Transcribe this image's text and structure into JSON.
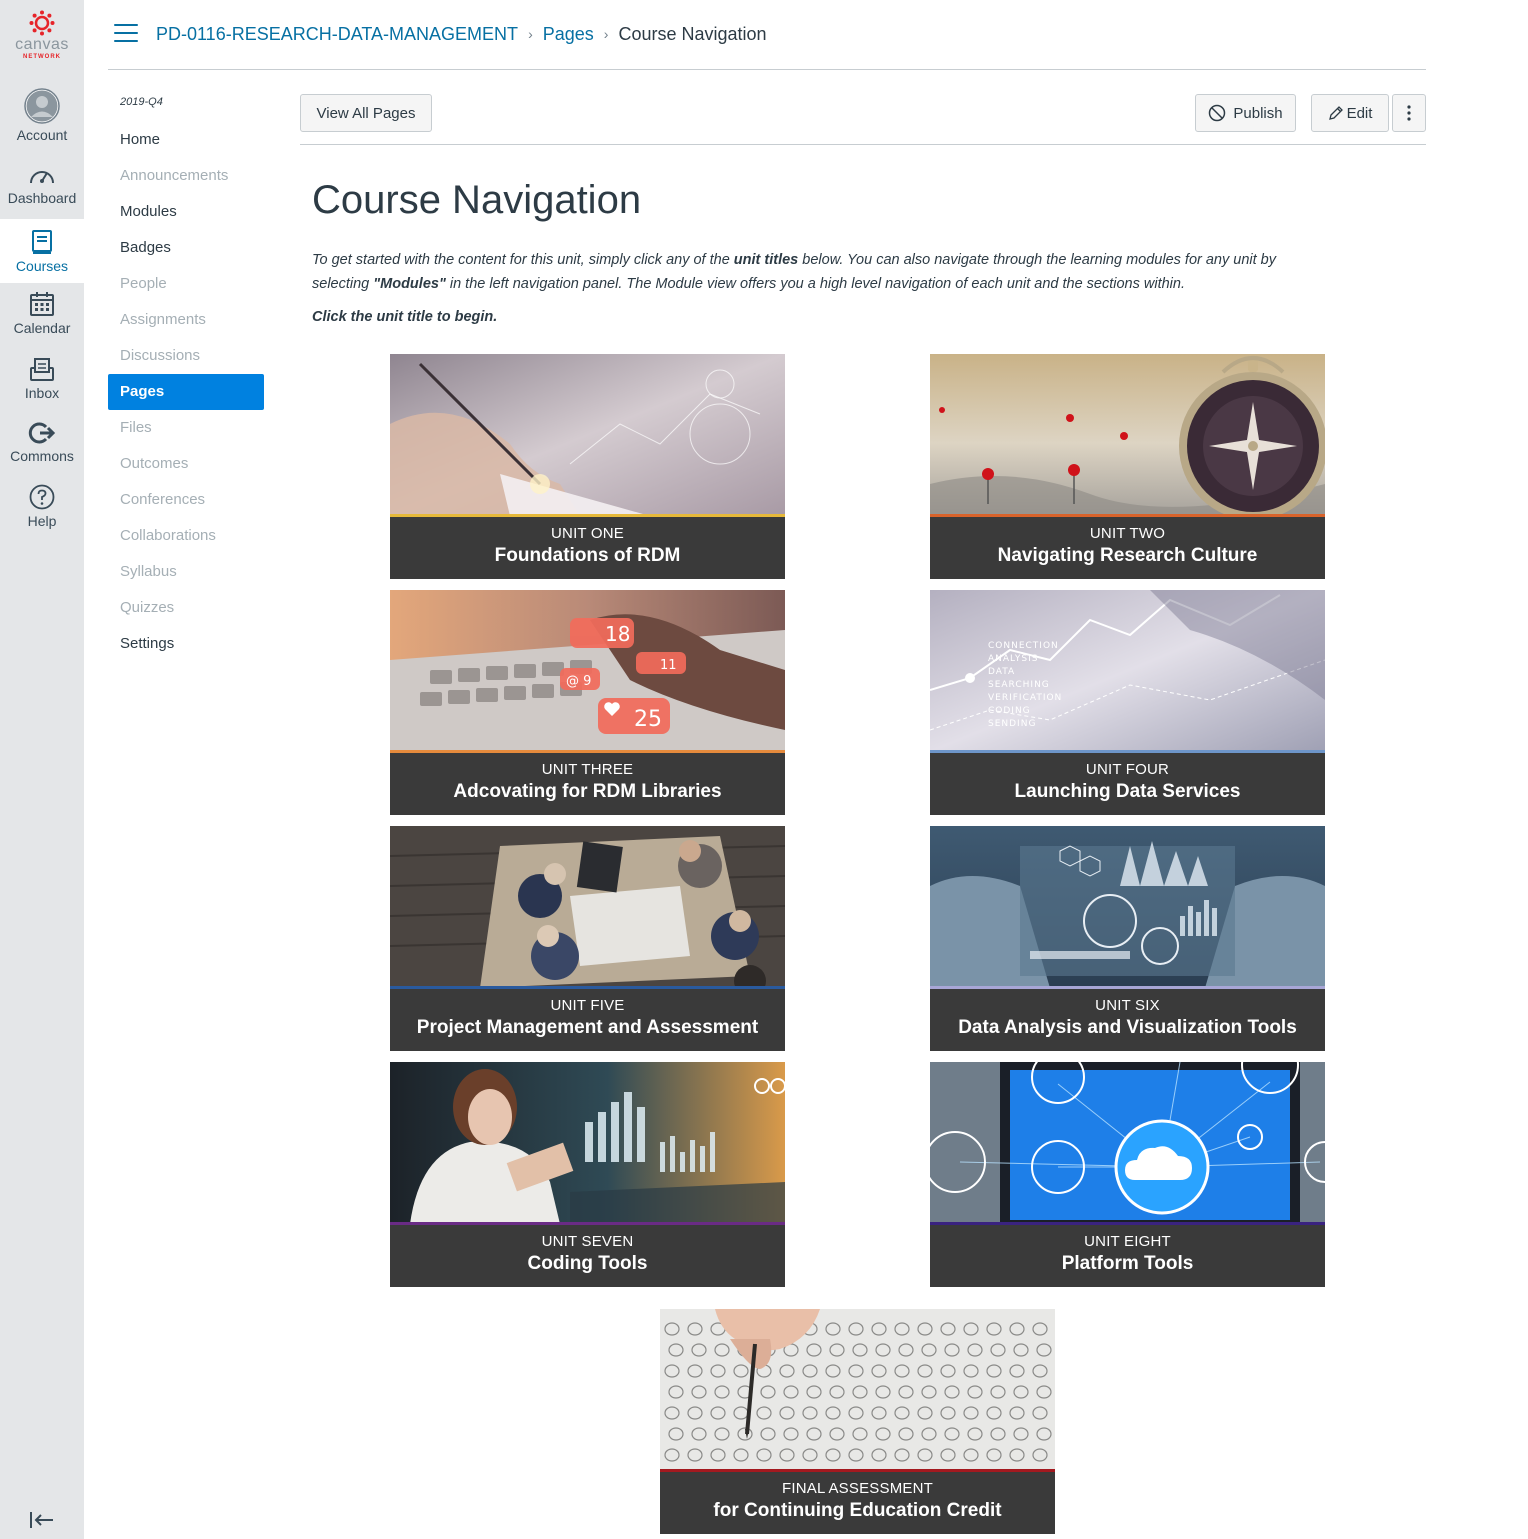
{
  "global_nav": {
    "brand_word": "canvas",
    "brand_sub": "NETWORK",
    "items": [
      {
        "label": "Account",
        "icon": "account-icon"
      },
      {
        "label": "Dashboard",
        "icon": "dashboard-icon"
      },
      {
        "label": "Courses",
        "icon": "courses-icon",
        "active": true
      },
      {
        "label": "Calendar",
        "icon": "calendar-icon"
      },
      {
        "label": "Inbox",
        "icon": "inbox-icon"
      },
      {
        "label": "Commons",
        "icon": "commons-icon"
      },
      {
        "label": "Help",
        "icon": "help-icon"
      }
    ]
  },
  "breadcrumb": {
    "course": "PD-0116-RESEARCH-DATA-MANAGEMENT",
    "section": "Pages",
    "current": "Course Navigation"
  },
  "course_nav": {
    "term": "2019-Q4",
    "items": [
      {
        "label": "Home"
      },
      {
        "label": "Announcements",
        "disabled": true
      },
      {
        "label": "Modules"
      },
      {
        "label": "Badges"
      },
      {
        "label": "People",
        "disabled": true
      },
      {
        "label": "Assignments",
        "disabled": true
      },
      {
        "label": "Discussions",
        "disabled": true
      },
      {
        "label": "Pages",
        "active": true
      },
      {
        "label": "Files",
        "disabled": true
      },
      {
        "label": "Outcomes",
        "disabled": true
      },
      {
        "label": "Conferences",
        "disabled": true
      },
      {
        "label": "Collaborations",
        "disabled": true
      },
      {
        "label": "Syllabus",
        "disabled": true
      },
      {
        "label": "Quizzes",
        "disabled": true
      },
      {
        "label": "Settings"
      }
    ]
  },
  "toolbar": {
    "view_all": "View All Pages",
    "publish": "Publish",
    "edit": "Edit"
  },
  "content": {
    "title": "Course Navigation",
    "intro_1": "To get started with the content for this unit, simply click any of the ",
    "intro_bold": "unit titles",
    "intro_2": " below. You can also navigate through the learning modules for any unit by selecting ",
    "intro_modules": "\"Modules\"",
    "intro_3": " in the left navigation panel. The Module view offers you a high level navigation of each unit and the sections within.",
    "begin": "Click the unit title to begin."
  },
  "units": [
    {
      "label": "UNIT ONE",
      "title": "Foundations of RDM",
      "accent": "#e6b93a"
    },
    {
      "label": "UNIT TWO",
      "title": "Navigating Research Culture",
      "accent": "#d8632b"
    },
    {
      "label": "UNIT THREE",
      "title": "Adcovating for RDM Libraries",
      "accent": "#e58a3c"
    },
    {
      "label": "UNIT FOUR",
      "title": "Launching Data Services",
      "accent": "#6d95c9"
    },
    {
      "label": "UNIT FIVE",
      "title": "Project Management and Assessment",
      "accent": "#2a5a9e"
    },
    {
      "label": "UNIT SIX",
      "title": "Data Analysis and Visualization Tools",
      "accent": "#a8a6d6"
    },
    {
      "label": "UNIT SEVEN",
      "title": "Coding Tools",
      "accent": "#6a2b85"
    },
    {
      "label": "UNIT EIGHT",
      "title": "Platform Tools",
      "accent": "#3a2380"
    },
    {
      "label": "FINAL ASSESSMENT",
      "title": "for Continuing Education Credit",
      "accent": "#a3191f"
    }
  ]
}
